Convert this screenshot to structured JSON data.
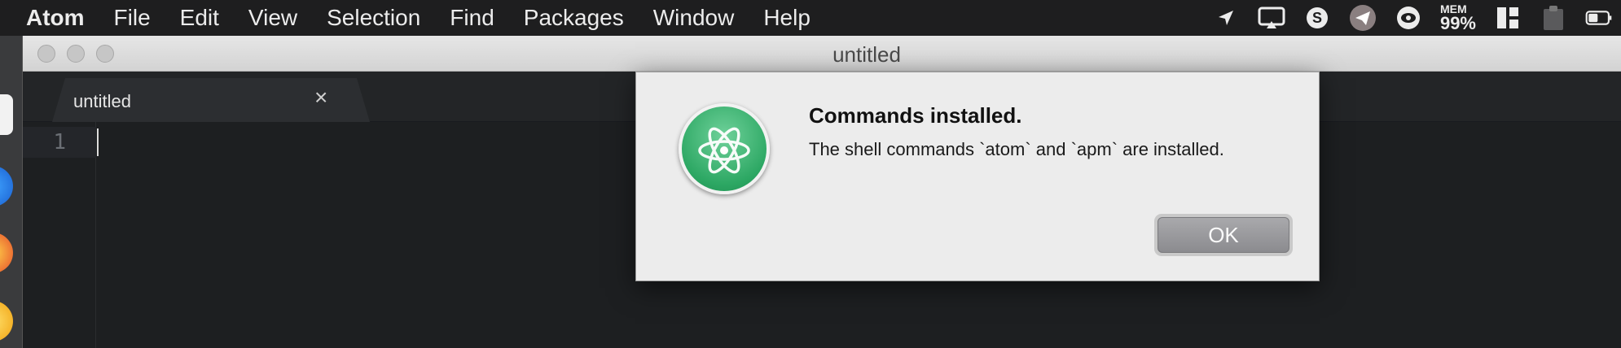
{
  "menubar": {
    "app": "Atom",
    "items": [
      "File",
      "Edit",
      "View",
      "Selection",
      "Find",
      "Packages",
      "Window",
      "Help"
    ],
    "mem_label": "MEM",
    "mem_value": "99%"
  },
  "status_icons": [
    "location-arrow-icon",
    "airplay-icon",
    "skype-icon",
    "telegram-icon",
    "eye-icon",
    "mem-monitor",
    "grid-icon",
    "clipboard-icon",
    "battery-icon"
  ],
  "window": {
    "title": "untitled",
    "tab_title": "untitled",
    "tab_close": "×",
    "line_number": "1"
  },
  "dialog": {
    "title": "Commands installed.",
    "message": "The shell commands `atom` and `apm` are installed.",
    "ok_label": "OK",
    "icon": "atom-app-icon"
  },
  "colors": {
    "menubar_bg": "#1e1e1f",
    "editor_bg": "#1d1f21",
    "dialog_bg": "#ececec",
    "atom_green": "#2ca763"
  }
}
